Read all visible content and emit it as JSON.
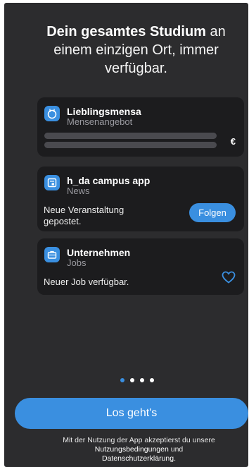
{
  "headline": {
    "bold": "Dein gesamtes Studium",
    "rest": " an einem einzigen Ort, immer verfügbar."
  },
  "cards": {
    "mensa": {
      "title": "Lieblingsmensa",
      "subtitle": "Mensenangebot",
      "currency": "€",
      "icon": "fork-knife-icon"
    },
    "news": {
      "title": "h_da campus app",
      "subtitle": "News",
      "text": "Neue Veranstaltung gepostet.",
      "button": "Folgen",
      "icon": "newspaper-icon"
    },
    "jobs": {
      "title": "Unternehmen",
      "subtitle": "Jobs",
      "text": "Neuer Job verfügbar.",
      "icon": "briefcase-icon"
    }
  },
  "pager": {
    "total": 4,
    "active": 0
  },
  "cta": {
    "label": "Los geht's"
  },
  "legal": {
    "prefix": "Mit der Nutzung der App akzeptierst  du unsere ",
    "terms": "Nutzungsbedingungen",
    "and": " und ",
    "privacy": "Datenschutzerklärung",
    "suffix": "."
  },
  "colors": {
    "accent": "#3a8fe0",
    "background": "#2c2c2e",
    "card": "#1c1c1e"
  }
}
